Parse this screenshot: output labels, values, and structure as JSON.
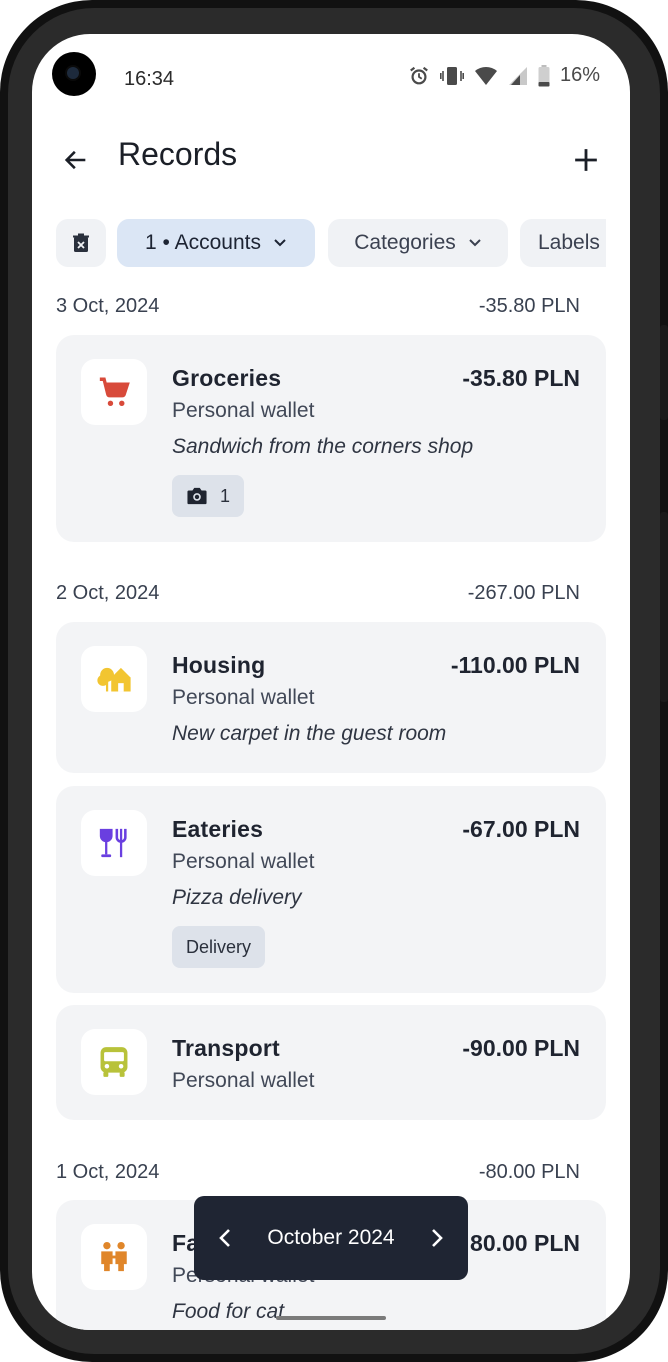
{
  "status_bar": {
    "time": "16:34",
    "battery": "16%",
    "icons": [
      "alarm-icon",
      "vibrate-icon",
      "wifi-icon",
      "signal-icon",
      "battery-icon"
    ]
  },
  "app_bar": {
    "title": "Records",
    "back_icon": "arrow-left-icon",
    "add_icon": "plus-icon"
  },
  "filters": {
    "clear_icon": "clear-filters-icon",
    "chips": [
      {
        "label": "1 • Accounts",
        "active": true
      },
      {
        "label": "Categories",
        "active": false
      },
      {
        "label": "Labels",
        "active": false
      }
    ]
  },
  "days": [
    {
      "date": "3 Oct, 2024",
      "total": "-35.80 PLN",
      "records": [
        {
          "category": "Groceries",
          "amount": "-35.80 PLN",
          "wallet": "Personal wallet",
          "note": "Sandwich from the corners shop",
          "attachment_count": "1",
          "icon": "cart-icon",
          "icon_color": "#d84a3a"
        }
      ]
    },
    {
      "date": "2 Oct, 2024",
      "total": "-267.00 PLN",
      "records": [
        {
          "category": "Housing",
          "amount": "-110.00 PLN",
          "wallet": "Personal wallet",
          "note": "New carpet in the guest room",
          "icon": "house-tree-icon",
          "icon_color": "#f2c531"
        },
        {
          "category": "Eateries",
          "amount": "-67.00 PLN",
          "wallet": "Personal wallet",
          "note": "Pizza delivery",
          "tag": "Delivery",
          "icon": "fork-glass-icon",
          "icon_color": "#6a3fe0"
        },
        {
          "category": "Transport",
          "amount": "-90.00 PLN",
          "wallet": "Personal wallet",
          "icon": "bus-icon",
          "icon_color": "#b8c23a"
        }
      ]
    },
    {
      "date": "1 Oct, 2024",
      "total": "-80.00 PLN",
      "records": [
        {
          "category": "Fa",
          "amount": "80.00 PLN",
          "wallet": "Personal wallet",
          "note": "Food for cat",
          "icon": "family-icon",
          "icon_color": "#e0862a"
        }
      ]
    }
  ],
  "month_nav": {
    "label": "October 2024",
    "prev_icon": "chevron-left-icon",
    "next_icon": "chevron-right-icon"
  }
}
